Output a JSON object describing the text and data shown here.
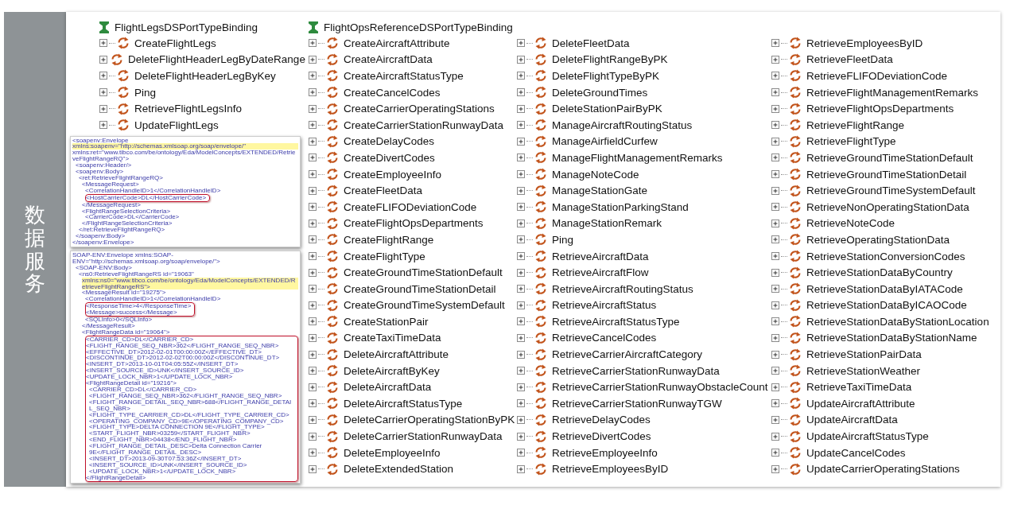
{
  "side_label": "数据服务",
  "bindings": [
    {
      "name": "FlightLegsDSPortTypeBinding",
      "operations": [
        {
          "name": "CreateFlightLegs",
          "expanded": false
        },
        {
          "name": "DeleteFlightHeaderLegByDateRange",
          "expanded": false
        },
        {
          "name": "DeleteFlightHeaderLegByKey",
          "expanded": false
        },
        {
          "name": "Ping",
          "expanded": false
        },
        {
          "name": "RetrieveFlightLegsInfo",
          "expanded": false
        },
        {
          "name": "UpdateFlightLegs",
          "expanded": false
        }
      ]
    },
    {
      "name": "FlightOpsReferenceDSPortTypeBinding",
      "operations": [
        {
          "name": "CreateAircraftAttribute",
          "expanded": false
        },
        {
          "name": "CreateAircraftData",
          "expanded": false
        },
        {
          "name": "CreateAircraftStatusType",
          "expanded": false
        },
        {
          "name": "CreateCancelCodes",
          "expanded": false
        },
        {
          "name": "CreateCarrierOperatingStations",
          "expanded": false
        },
        {
          "name": "CreateCarrierStationRunwayData",
          "expanded": false
        },
        {
          "name": "CreateDelayCodes",
          "expanded": false
        },
        {
          "name": "CreateDivertCodes",
          "expanded": false
        },
        {
          "name": "CreateEmployeeInfo",
          "expanded": false
        },
        {
          "name": "CreateFleetData",
          "expanded": false
        },
        {
          "name": "CreateFLIFODeviationCode",
          "expanded": false
        },
        {
          "name": "CreateFlightOpsDepartments",
          "expanded": false
        },
        {
          "name": "CreateFlightRange",
          "expanded": false
        },
        {
          "name": "CreateFlightType",
          "expanded": false
        },
        {
          "name": "CreateGroundTimeStationDefault",
          "expanded": false
        },
        {
          "name": "CreateGroundTimeStationDetail",
          "expanded": false
        },
        {
          "name": "CreateGroundTimeSystemDefault",
          "expanded": false
        },
        {
          "name": "CreateStationPair",
          "expanded": false
        },
        {
          "name": "CreateTaxiTimeData",
          "expanded": false
        },
        {
          "name": "DeleteAircraftAttribute",
          "expanded": false
        },
        {
          "name": "DeleteAircraftByKey",
          "expanded": false
        },
        {
          "name": "DeleteAircraftData",
          "expanded": false
        },
        {
          "name": "DeleteAircraftStatusType",
          "expanded": false
        },
        {
          "name": "DeleteCarrierOperatingStationByPK",
          "expanded": false
        },
        {
          "name": "DeleteCarrierStationRunwayData",
          "expanded": false
        },
        {
          "name": "DeleteEmployeeInfo",
          "expanded": false
        },
        {
          "name": "DeleteExtendedStation",
          "expanded": false
        },
        {
          "name": "DeleteFleetData",
          "expanded": false
        },
        {
          "name": "DeleteFlightRangeByPK",
          "expanded": false
        },
        {
          "name": "DeleteFlightTypeByPK",
          "expanded": false
        },
        {
          "name": "DeleteGroundTimes",
          "expanded": false
        },
        {
          "name": "DeleteStationPairByPK",
          "expanded": false
        },
        {
          "name": "ManageAircraftRoutingStatus",
          "expanded": false
        },
        {
          "name": "ManageAirfieldCurfew",
          "expanded": false
        },
        {
          "name": "ManageFlightManagementRemarks",
          "expanded": false
        },
        {
          "name": "ManageNoteCode",
          "expanded": false
        },
        {
          "name": "ManageStationGate",
          "expanded": false
        },
        {
          "name": "ManageStationParkingStand",
          "expanded": false
        },
        {
          "name": "ManageStationRemark",
          "expanded": false
        },
        {
          "name": "Ping",
          "expanded": false
        },
        {
          "name": "RetrieveAircraftData",
          "expanded": false
        },
        {
          "name": "RetrieveAircraftFlow",
          "expanded": false
        },
        {
          "name": "RetrieveAircraftRoutingStatus",
          "expanded": false
        },
        {
          "name": "RetrieveAircraftStatus",
          "expanded": false
        },
        {
          "name": "RetrieveAircraftStatusType",
          "expanded": false
        },
        {
          "name": "RetrieveCancelCodes",
          "expanded": false
        },
        {
          "name": "RetrieveCarrierAircraftCategory",
          "expanded": false
        },
        {
          "name": "RetrieveCarrierStationRunwayData",
          "expanded": false
        },
        {
          "name": "RetrieveCarrierStationRunwayObstacleCount",
          "expanded": false
        },
        {
          "name": "RetrieveCarrierStationRunwayTGW",
          "expanded": false
        },
        {
          "name": "RetrieveDelayCodes",
          "expanded": false
        },
        {
          "name": "RetrieveDivertCodes",
          "expanded": false
        },
        {
          "name": "RetrieveEmployeeInfo",
          "expanded": false
        },
        {
          "name": "RetrieveEmployeesByID",
          "expanded": false
        },
        {
          "name": "RetrieveEmployeesByID",
          "expanded": false
        },
        {
          "name": "RetrieveFleetData",
          "expanded": false
        },
        {
          "name": "RetrieveFLIFODeviationCode",
          "expanded": false
        },
        {
          "name": "RetrieveFlightManagementRemarks",
          "expanded": false
        },
        {
          "name": "RetrieveFlightOpsDepartments",
          "expanded": false
        },
        {
          "name": "RetrieveFlightRange",
          "expanded": false
        },
        {
          "name": "RetrieveFlightType",
          "expanded": false
        },
        {
          "name": "RetrieveGroundTimeStationDefault",
          "expanded": false
        },
        {
          "name": "RetrieveGroundTimeStationDetail",
          "expanded": false
        },
        {
          "name": "RetrieveGroundTimeSystemDefault",
          "expanded": false
        },
        {
          "name": "RetrieveNonOperatingStationData",
          "expanded": false
        },
        {
          "name": "RetrieveNoteCode",
          "expanded": false
        },
        {
          "name": "RetrieveOperatingStationData",
          "expanded": false
        },
        {
          "name": "RetrieveStationConversionCodes",
          "expanded": false
        },
        {
          "name": "RetrieveStationDataByCountry",
          "expanded": false
        },
        {
          "name": "RetrieveStationDataByIATACode",
          "expanded": false
        },
        {
          "name": "RetrieveStationDataByICAOCode",
          "expanded": false
        },
        {
          "name": "RetrieveStationDataByStationLocation",
          "expanded": false
        },
        {
          "name": "RetrieveStationDataByStationName",
          "expanded": false
        },
        {
          "name": "RetrieveStationPairData",
          "expanded": false
        },
        {
          "name": "RetrieveStationWeather",
          "expanded": false
        },
        {
          "name": "RetrieveTaxiTimeData",
          "expanded": false
        },
        {
          "name": "UpdateAircraftAttribute",
          "expanded": false
        },
        {
          "name": "UpdateAircraftData",
          "expanded": false
        },
        {
          "name": "UpdateAircraftStatusType",
          "expanded": false
        },
        {
          "name": "UpdateCancelCodes",
          "expanded": false
        },
        {
          "name": "UpdateCarrierOperatingStations",
          "expanded": false
        }
      ]
    }
  ],
  "xml_panels": [
    {
      "lines": [
        {
          "kind": "line",
          "text": "<soapenv:Envelope",
          "highlighted": false
        },
        {
          "kind": "line",
          "text": "xmlns:soapenv=\"http://schemas.xmlsoap.org/soap/envelope/\"",
          "highlighted": true
        },
        {
          "kind": "line",
          "text": "xmlns:ret=\"www.tibco.com/be/ontology/Eda/ModelConcepts/EXTENDED/RetrieveFlightRangeRQ\">",
          "highlighted": false,
          "children": [
            {
              "kind": "line",
              "text": "<soapenv:Header/>",
              "highlighted": false
            },
            {
              "kind": "line",
              "text": "<soapenv:Body>",
              "highlighted": false,
              "children": [
                {
                  "kind": "line",
                  "text": "<ret:RetrieveFlightRangeRQ>",
                  "highlighted": false,
                  "children": [
                    {
                      "kind": "line",
                      "text": "<MessageRequest>",
                      "highlighted": false,
                      "children": [
                        {
                          "kind": "line",
                          "text": "<CorrelationHandleID>1</CorrelationHandleID>",
                          "highlighted": false
                        },
                        {
                          "kind": "callout",
                          "children": [
                            {
                              "kind": "line",
                              "text": "<HostCarrierCode>DL</HostCarrierCode>",
                              "highlighted": false
                            }
                          ]
                        }
                      ]
                    },
                    {
                      "kind": "line",
                      "text": "</MessageRequest>",
                      "highlighted": false
                    },
                    {
                      "kind": "line",
                      "text": "<FlightRangeSelectionCriteria>",
                      "highlighted": false,
                      "children": [
                        {
                          "kind": "line",
                          "text": "<CarrierCode>DL</CarrierCode>",
                          "highlighted": false
                        }
                      ]
                    },
                    {
                      "kind": "line",
                      "text": "</FlightRangeSelectionCriteria>",
                      "highlighted": false
                    }
                  ]
                },
                {
                  "kind": "line",
                  "text": "</ret:RetrieveFlightRangeRQ>",
                  "highlighted": false
                }
              ]
            },
            {
              "kind": "line",
              "text": "</soapenv:Body>",
              "highlighted": false
            }
          ]
        },
        {
          "kind": "line",
          "text": "</soapenv:Envelope>",
          "highlighted": false
        }
      ]
    },
    {
      "lines": [
        {
          "kind": "line",
          "text": "SOAP-ENV:Envelope xmlns:SOAP-ENV=\"http://schemas.xmlsoap.org/soap/envelope/\">",
          "highlighted": false,
          "children": [
            {
              "kind": "line",
              "text": "<SOAP-ENV:Body>",
              "highlighted": false,
              "children": [
                {
                  "kind": "line",
                  "text": "<ns0:RetrieveFlightRangeRS id=\"19063\"",
                  "highlighted": false,
                  "children": [
                    {
                      "kind": "line",
                      "text": "xmlns:ns0=\"www.tibco.com/be/ontology/Eda/ModelConcepts/EXTENDED/RetrieveFlightRangeRS\">",
                      "highlighted": true
                    },
                    {
                      "kind": "line",
                      "text": "<MessageResult id=\"19275\">",
                      "highlighted": false,
                      "children": [
                        {
                          "kind": "line",
                          "text": "<CorrelationHandleID>1</CorrelationHandleID>",
                          "highlighted": false
                        },
                        {
                          "kind": "callout",
                          "children": [
                            {
                              "kind": "line",
                              "text": "<ResponseTime>4</ResponseTime>",
                              "highlighted": false
                            },
                            {
                              "kind": "line",
                              "text": "<Message>success</Message>",
                              "highlighted": false
                            }
                          ]
                        },
                        {
                          "kind": "line",
                          "text": "<SQLInfo>0</SQLInfo>",
                          "highlighted": false
                        }
                      ]
                    },
                    {
                      "kind": "line",
                      "text": "</MessageResult>",
                      "highlighted": false
                    },
                    {
                      "kind": "line",
                      "text": "<FlightRangeData id=\"19064\">",
                      "highlighted": false,
                      "children": [
                        {
                          "kind": "callout",
                          "children": [
                            {
                              "kind": "line",
                              "text": "<CARRIER_CD>DL</CARRIER_CD>",
                              "highlighted": false
                            },
                            {
                              "kind": "line",
                              "text": "<FLIGHT_RANGE_SEQ_NBR>362</FLIGHT_RANGE_SEQ_NBR>",
                              "highlighted": false
                            },
                            {
                              "kind": "line",
                              "text": "<EFFECTIVE_DT>2012-02-01T00:00:00Z</EFFECTIVE_DT>",
                              "highlighted": false
                            },
                            {
                              "kind": "line",
                              "text": "<DISCONTINUE_DT>2012-02-02T00:00:00Z</DISCONTINUE_DT>",
                              "highlighted": false
                            },
                            {
                              "kind": "line",
                              "text": "<INSERT_DT>2013-10-01T04:05:55Z</INSERT_DT>",
                              "highlighted": false
                            },
                            {
                              "kind": "line",
                              "text": "<INSERT_SOURCE_ID>UNK</INSERT_SOURCE_ID>",
                              "highlighted": false
                            },
                            {
                              "kind": "line",
                              "text": "<UPDATE_LOCK_NBR>1</UPDATE_LOCK_NBR>",
                              "highlighted": false
                            },
                            {
                              "kind": "line",
                              "text": "<FlightRangeDetail id=\"19216\">",
                              "highlighted": false,
                              "children": [
                                {
                                  "kind": "line",
                                  "text": "<CARRIER_CD>DL</CARRIER_CD>",
                                  "highlighted": false
                                },
                                {
                                  "kind": "line",
                                  "text": "<FLIGHT_RANGE_SEQ_NBR>362</FLIGHT_RANGE_SEQ_NBR>",
                                  "highlighted": false
                                },
                                {
                                  "kind": "line",
                                  "text": "<FLIGHT_RANGE_DETAIL_SEQ_NBR>688</FLIGHT_RANGE_DETAIL_SEQ_NBR>",
                                  "highlighted": false
                                },
                                {
                                  "kind": "line",
                                  "text": "<FLIGHT_TYPE_CARRIER_CD>DL</FLIGHT_TYPE_CARRIER_CD>",
                                  "highlighted": false
                                },
                                {
                                  "kind": "line",
                                  "text": "<OPERATING_COMPANY_CD>9E</OPERATING_COMPANY_CD>",
                                  "highlighted": false
                                },
                                {
                                  "kind": "line",
                                  "text": "<FLIGHT_TYPE>DELTA CONNECTION 9E</FLIGHT_TYPE>",
                                  "highlighted": false
                                },
                                {
                                  "kind": "line",
                                  "text": "<START_FLIGHT_NBR>03259</START_FLIGHT_NBR>",
                                  "highlighted": false
                                },
                                {
                                  "kind": "line",
                                  "text": "<END_FLIGHT_NBR>04438</END_FLIGHT_NBR>",
                                  "highlighted": false
                                },
                                {
                                  "kind": "line",
                                  "text": "<FLIGHT_RANGE_DETAIL_DESC>Delta Connection Carrier 9E</FLIGHT_RANGE_DETAIL_DESC>",
                                  "highlighted": false
                                },
                                {
                                  "kind": "line",
                                  "text": "<INSERT_DT>2013-09-30T07:53:36Z</INSERT_DT>",
                                  "highlighted": false
                                },
                                {
                                  "kind": "line",
                                  "text": "<INSERT_SOURCE_ID>UNK</INSERT_SOURCE_ID>",
                                  "highlighted": false
                                },
                                {
                                  "kind": "line",
                                  "text": "<UPDATE_LOCK_NBR>1</UPDATE_LOCK_NBR>",
                                  "highlighted": false
                                }
                              ]
                            },
                            {
                              "kind": "line",
                              "text": "</FlightRangeDetail>",
                              "highlighted": false
                            }
                          ]
                        }
                      ]
                    }
                  ]
                }
              ]
            }
          ]
        }
      ]
    }
  ]
}
